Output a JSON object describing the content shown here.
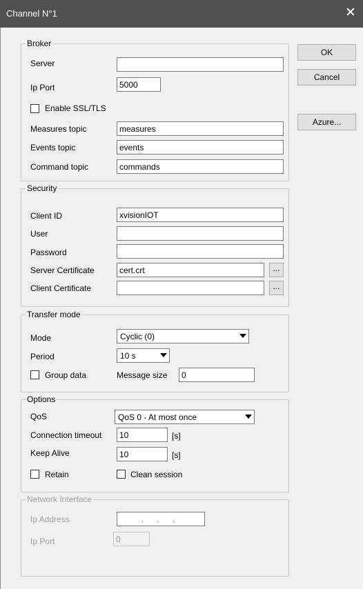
{
  "window": {
    "title": "Channel N°1",
    "close_glyph": "✕"
  },
  "buttons": {
    "ok": "OK",
    "cancel": "Cancel",
    "azure": "Azure..."
  },
  "broker": {
    "legend": "Broker",
    "server_label": "Server",
    "server_value": "",
    "port_label": "Ip Port",
    "port_value": "5000",
    "ssl_label": "Enable SSL/TLS",
    "measures_label": "Measures topic",
    "measures_value": "measures",
    "events_label": "Events topic",
    "events_value": "events",
    "command_label": "Command topic",
    "command_value": "commands"
  },
  "security": {
    "legend": "Security",
    "client_id_label": "Client ID",
    "client_id_value": "xvisionIOT",
    "user_label": "User",
    "user_value": "",
    "password_label": "Password",
    "password_value": "",
    "server_cert_label": "Server Certificate",
    "server_cert_value": "cert.crt",
    "client_cert_label": "Client Certificate",
    "client_cert_value": "",
    "browse_label": "..."
  },
  "transfer": {
    "legend": "Transfer mode",
    "mode_label": "Mode",
    "mode_value": "Cyclic (0)",
    "period_label": "Period",
    "period_value": "10 s",
    "group_label": "Group data",
    "msgsize_label": "Message size",
    "msgsize_value": "0"
  },
  "options": {
    "legend": "Options",
    "qos_label": "QoS",
    "qos_value": "QoS 0 - At most once",
    "timeout_label": "Connection timeout",
    "timeout_value": "10",
    "timeout_unit": "[s]",
    "keepalive_label": "Keep Alive",
    "keepalive_value": "10",
    "keepalive_unit": "[s]",
    "retain_label": "Retain",
    "clean_label": "Clean session"
  },
  "network": {
    "legend": "Network Interface",
    "ip_label": "Ip Address",
    "ip_value": ". . .",
    "port_label": "Ip Port",
    "port_value": "0"
  }
}
